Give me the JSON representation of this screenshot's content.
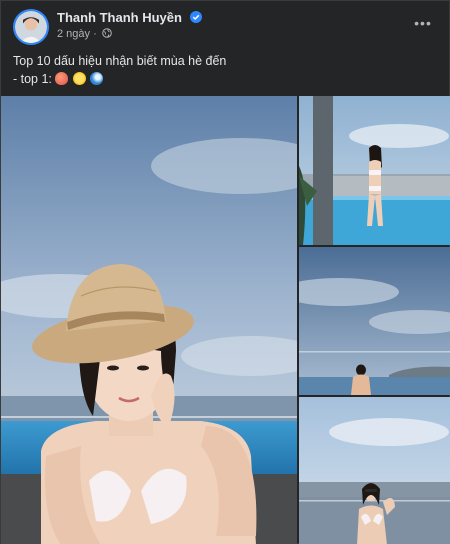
{
  "post": {
    "author": "Thanh Thanh Huyền",
    "time": "2 ngày",
    "time_separator": "·",
    "more_label": "•••",
    "caption_line1": "Top 10 dấu hiệu nhận biết mùa hè đến",
    "caption_line2": "- top 1:",
    "caption_emojis": [
      "peach-emoji",
      "sun-emoji",
      "wave-emoji"
    ],
    "photos": [
      {
        "name": "photo-main"
      },
      {
        "name": "photo-pool-standing"
      },
      {
        "name": "photo-sea-view"
      },
      {
        "name": "photo-selfie-city"
      }
    ]
  },
  "colors": {
    "background": "#242526",
    "text": "#e4e6eb",
    "secondary_text": "#b0b3b8",
    "verified_blue": "#2d88ff"
  }
}
